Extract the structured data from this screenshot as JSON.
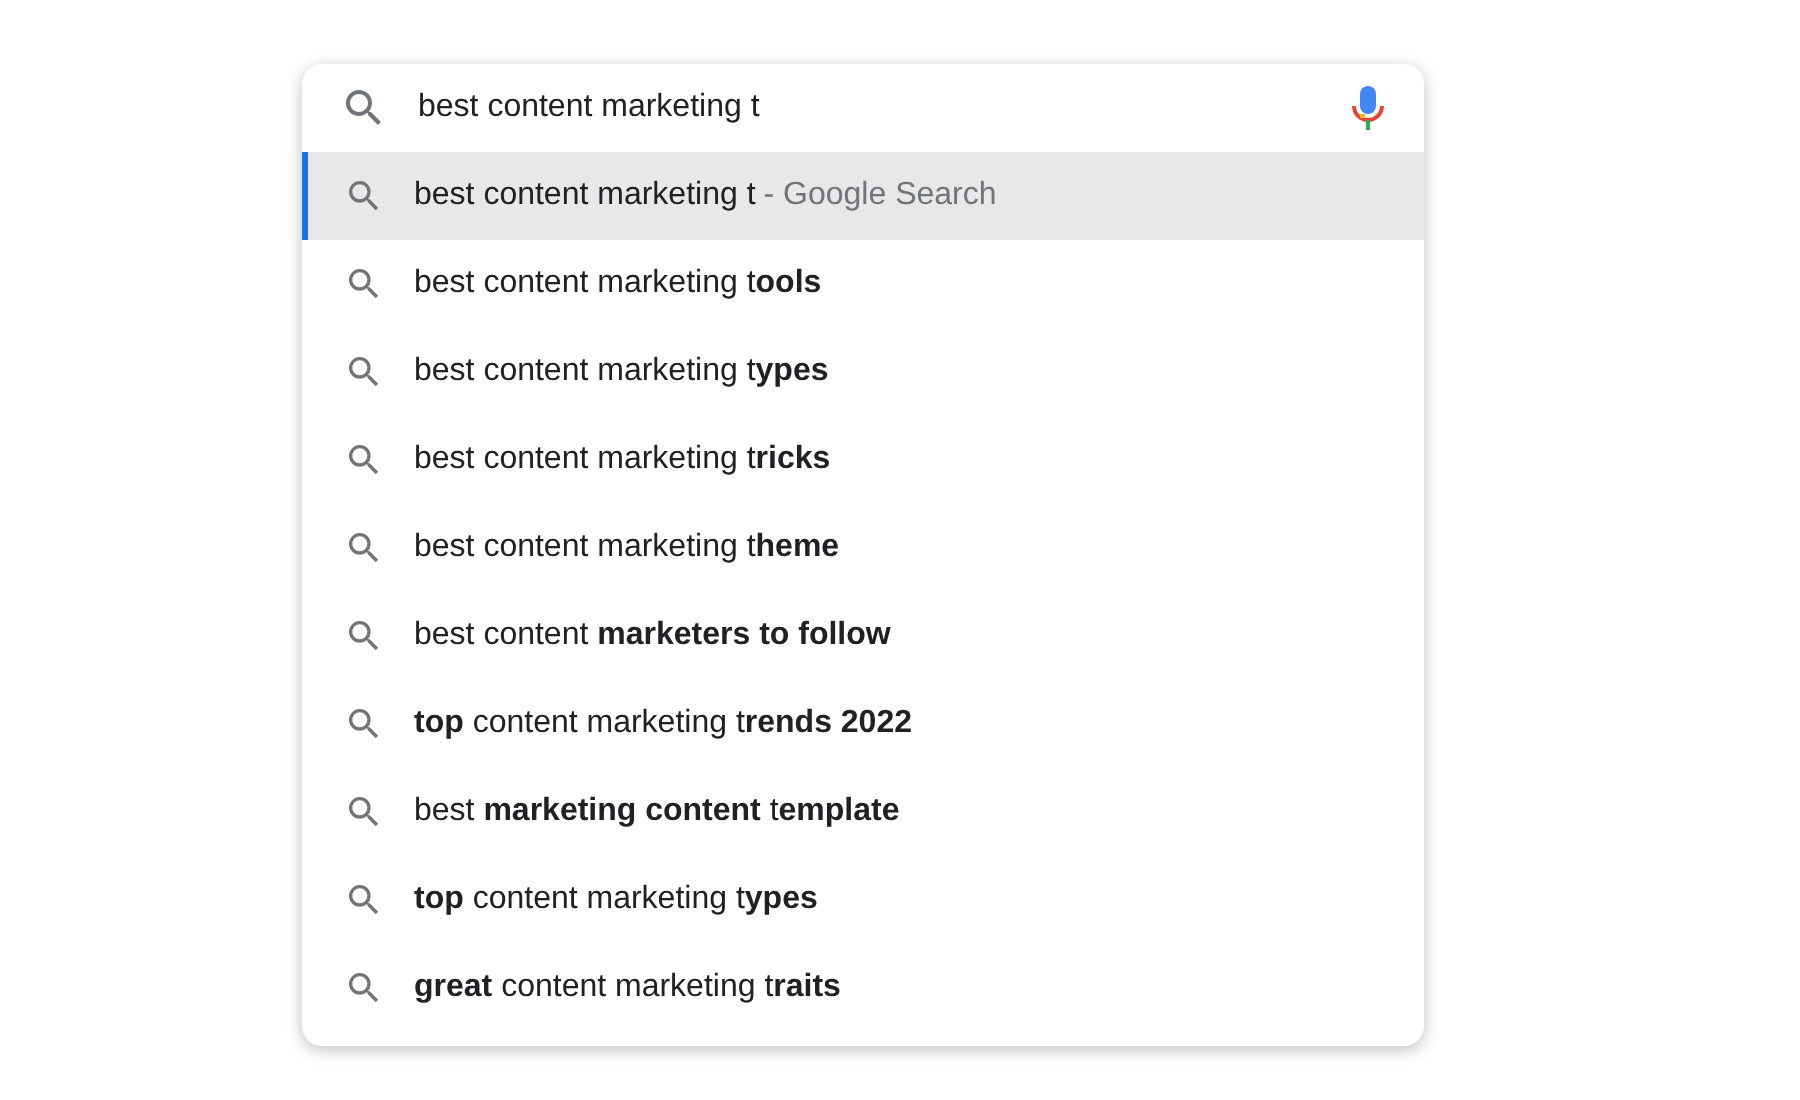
{
  "search": {
    "value": "best content marketing t"
  },
  "suggestions": [
    {
      "text": "best content marketing t",
      "suffix": "- Google Search",
      "selected": true
    },
    {
      "text": "best content marketing t**ools**",
      "selected": false
    },
    {
      "text": "best content marketing t**ypes**",
      "selected": false
    },
    {
      "text": "best content marketing t**ricks**",
      "selected": false
    },
    {
      "text": "best content marketing t**heme**",
      "selected": false
    },
    {
      "text": "best content **marketers to follow**",
      "selected": false
    },
    {
      "text": "**top** content marketing t**rends 2022**",
      "selected": false
    },
    {
      "text": "best **marketing content** t**emplate**",
      "selected": false
    },
    {
      "text": "**top** content marketing t**ypes**",
      "selected": false
    },
    {
      "text": "**great** content marketing t**raits**",
      "selected": false
    }
  ]
}
